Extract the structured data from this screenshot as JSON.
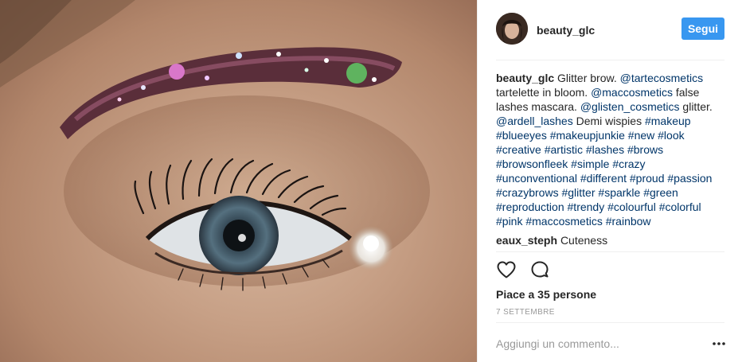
{
  "post": {
    "username": "beauty_glc",
    "follow_label": "Segui",
    "caption_parts": [
      {
        "t": "Glitter brow. ",
        "k": "text"
      },
      {
        "t": "@tartecosmetics",
        "k": "tag"
      },
      {
        "t": " tartelette in bloom. ",
        "k": "text"
      },
      {
        "t": "@maccosmetics",
        "k": "tag"
      },
      {
        "t": " false lashes mascara. ",
        "k": "text"
      },
      {
        "t": "@glisten_cosmetics",
        "k": "tag"
      },
      {
        "t": " glitter. ",
        "k": "text"
      },
      {
        "t": "@ardell_lashes",
        "k": "tag"
      },
      {
        "t": " Demi wispies ",
        "k": "text"
      },
      {
        "t": "#makeup",
        "k": "tag"
      },
      {
        "t": " ",
        "k": "text"
      },
      {
        "t": "#blueeyes",
        "k": "tag"
      },
      {
        "t": " ",
        "k": "text"
      },
      {
        "t": "#makeupjunkie",
        "k": "tag"
      },
      {
        "t": " ",
        "k": "text"
      },
      {
        "t": "#new",
        "k": "tag"
      },
      {
        "t": " ",
        "k": "text"
      },
      {
        "t": "#look",
        "k": "tag"
      },
      {
        "t": " ",
        "k": "text"
      },
      {
        "t": "#creative",
        "k": "tag"
      },
      {
        "t": " ",
        "k": "text"
      },
      {
        "t": "#artistic",
        "k": "tag"
      },
      {
        "t": " ",
        "k": "text"
      },
      {
        "t": "#lashes",
        "k": "tag"
      },
      {
        "t": " ",
        "k": "text"
      },
      {
        "t": "#brows",
        "k": "tag"
      },
      {
        "t": " ",
        "k": "text"
      },
      {
        "t": "#browsonfleek",
        "k": "tag"
      },
      {
        "t": " ",
        "k": "text"
      },
      {
        "t": "#simple",
        "k": "tag"
      },
      {
        "t": " ",
        "k": "text"
      },
      {
        "t": "#crazy",
        "k": "tag"
      },
      {
        "t": " ",
        "k": "text"
      },
      {
        "t": "#unconventional",
        "k": "tag"
      },
      {
        "t": " ",
        "k": "text"
      },
      {
        "t": "#different",
        "k": "tag"
      },
      {
        "t": " ",
        "k": "text"
      },
      {
        "t": "#proud",
        "k": "tag"
      },
      {
        "t": " ",
        "k": "text"
      },
      {
        "t": "#passion",
        "k": "tag"
      },
      {
        "t": " ",
        "k": "text"
      },
      {
        "t": "#crazybrows",
        "k": "tag"
      },
      {
        "t": " ",
        "k": "text"
      },
      {
        "t": "#glitter",
        "k": "tag"
      },
      {
        "t": " ",
        "k": "text"
      },
      {
        "t": "#sparkle",
        "k": "tag"
      },
      {
        "t": " ",
        "k": "text"
      },
      {
        "t": "#green",
        "k": "tag"
      },
      {
        "t": " ",
        "k": "text"
      },
      {
        "t": "#reproduction",
        "k": "tag"
      },
      {
        "t": " ",
        "k": "text"
      },
      {
        "t": "#trendy",
        "k": "tag"
      },
      {
        "t": " ",
        "k": "text"
      },
      {
        "t": "#colourful",
        "k": "tag"
      },
      {
        "t": " ",
        "k": "text"
      },
      {
        "t": "#colorful",
        "k": "tag"
      },
      {
        "t": " ",
        "k": "text"
      },
      {
        "t": "#pink",
        "k": "tag"
      },
      {
        "t": " ",
        "k": "text"
      },
      {
        "t": "#maccosmetics",
        "k": "tag"
      },
      {
        "t": " ",
        "k": "text"
      },
      {
        "t": "#rainbow",
        "k": "tag"
      }
    ],
    "comments": [
      {
        "username": "eaux_steph",
        "text": "Cuteness"
      }
    ],
    "likes_text": "Piace a 35 persone",
    "date_text": "7 SETTEMBRE",
    "comment_placeholder": "Aggiungi un commento...",
    "icons": {
      "like": "heart-icon",
      "comment": "speech-bubble-icon",
      "options": "ellipsis-icon"
    },
    "colors": {
      "follow_button": "#3897f0",
      "link": "#003569",
      "muted": "#999999"
    }
  }
}
